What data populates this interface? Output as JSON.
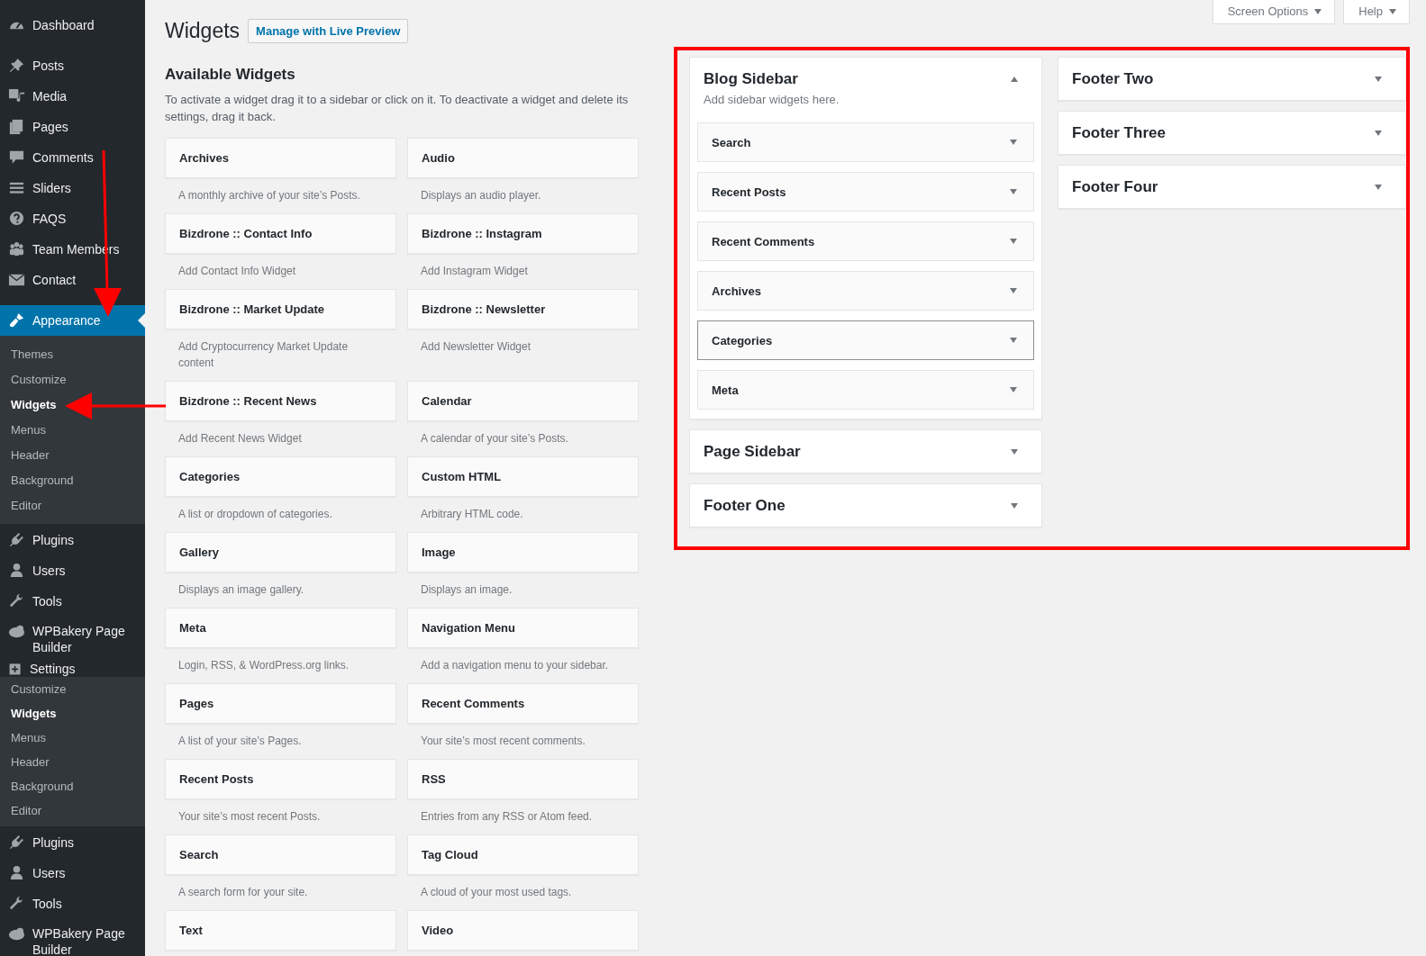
{
  "admin_menu": [
    {
      "kind": "item",
      "label": "Dashboard",
      "selected": false
    },
    {
      "kind": "separator"
    },
    {
      "kind": "item",
      "label": "Posts",
      "selected": false
    },
    {
      "kind": "item",
      "label": "Media",
      "selected": false
    },
    {
      "kind": "item",
      "label": "Pages",
      "selected": false
    },
    {
      "kind": "item",
      "label": "Comments",
      "selected": false
    },
    {
      "kind": "item",
      "label": "Sliders",
      "selected": false
    },
    {
      "kind": "item",
      "label": "FAQS",
      "selected": false
    },
    {
      "kind": "item",
      "label": "Team Members",
      "selected": false
    },
    {
      "kind": "item",
      "label": "Contact",
      "selected": false
    },
    {
      "kind": "separator"
    },
    {
      "kind": "item",
      "label": "Appearance",
      "selected": true
    },
    {
      "kind": "submenu",
      "items": [
        {
          "label": "Themes",
          "selected": false
        },
        {
          "label": "Customize",
          "selected": false
        },
        {
          "label": "Widgets",
          "selected": true
        },
        {
          "label": "Menus",
          "selected": false
        },
        {
          "label": "Header",
          "selected": false
        },
        {
          "label": "Background",
          "selected": false
        },
        {
          "label": "Editor",
          "selected": false
        }
      ]
    },
    {
      "kind": "item",
      "label": "Plugins",
      "selected": false
    },
    {
      "kind": "item",
      "label": "Users",
      "selected": false
    },
    {
      "kind": "item",
      "label": "Tools",
      "selected": false
    },
    {
      "kind": "item",
      "label": "WPBakery Page Builder",
      "selected": false
    },
    {
      "kind": "item",
      "label": "Settings",
      "selected": false
    },
    {
      "kind": "submenu",
      "items": [
        {
          "label": "Customize",
          "selected": false
        },
        {
          "label": "Widgets",
          "selected": true
        },
        {
          "label": "Menus",
          "selected": false
        },
        {
          "label": "Header",
          "selected": false
        },
        {
          "label": "Background",
          "selected": false
        },
        {
          "label": "Editor",
          "selected": false
        }
      ]
    },
    {
      "kind": "item",
      "label": "Plugins",
      "selected": false
    },
    {
      "kind": "item",
      "label": "Users",
      "selected": false
    },
    {
      "kind": "item",
      "label": "Tools",
      "selected": false
    },
    {
      "kind": "item",
      "label": "WPBakery Page Builder",
      "selected": false
    }
  ],
  "screen_meta": [
    "Screen Options",
    "Help"
  ],
  "page": {
    "title": "Widgets",
    "action": "Manage with Live Preview"
  },
  "available_widgets": {
    "heading": "Available Widgets",
    "description": "To activate a widget drag it to a sidebar or click on it. To deactivate a widget and delete its settings, drag it back.",
    "widgets": [
      {
        "name": "Archives",
        "description": "A monthly archive of your site’s Posts."
      },
      {
        "name": "Audio",
        "description": "Displays an audio player."
      },
      {
        "name": "Bizdrone :: Contact Info",
        "description": "Add Contact Info Widget"
      },
      {
        "name": "Bizdrone :: Instagram",
        "description": "Add Instagram Widget"
      },
      {
        "name": "Bizdrone :: Market Update",
        "description": "Add Cryptocurrency Market Update content"
      },
      {
        "name": "Bizdrone :: Newsletter",
        "description": "Add Newsletter Widget"
      },
      {
        "name": "Bizdrone :: Recent News",
        "description": "Add Recent News Widget"
      },
      {
        "name": "Calendar",
        "description": "A calendar of your site’s Posts."
      },
      {
        "name": "Categories",
        "description": "A list or dropdown of categories."
      },
      {
        "name": "Custom HTML",
        "description": "Arbitrary HTML code."
      },
      {
        "name": "Gallery",
        "description": "Displays an image gallery."
      },
      {
        "name": "Image",
        "description": "Displays an image."
      },
      {
        "name": "Meta",
        "description": "Login, RSS, & WordPress.org links."
      },
      {
        "name": "Navigation Menu",
        "description": "Add a navigation menu to your sidebar."
      },
      {
        "name": "Pages",
        "description": "A list of your site’s Pages."
      },
      {
        "name": "Recent Comments",
        "description": "Your site’s most recent comments."
      },
      {
        "name": "Recent Posts",
        "description": "Your site’s most recent Posts."
      },
      {
        "name": "RSS",
        "description": "Entries from any RSS or Atom feed."
      },
      {
        "name": "Search",
        "description": "A search form for your site."
      },
      {
        "name": "Tag Cloud",
        "description": "A cloud of your most used tags."
      },
      {
        "name": "Text"
      },
      {
        "name": "Video"
      }
    ]
  },
  "sidebars": {
    "columns": [
      [
        {
          "title": "Blog Sidebar",
          "description": "Add sidebar widgets here.",
          "expanded": true,
          "widgets": [
            {
              "name": "Search",
              "focused": false
            },
            {
              "name": "Recent Posts",
              "focused": false
            },
            {
              "name": "Recent Comments",
              "focused": false
            },
            {
              "name": "Archives",
              "focused": false
            },
            {
              "name": "Categories",
              "focused": true
            },
            {
              "name": "Meta",
              "focused": false
            }
          ]
        },
        {
          "title": "Page Sidebar",
          "expanded": false
        },
        {
          "title": "Footer One",
          "expanded": false
        }
      ],
      [
        {
          "title": "Footer Two",
          "expanded": false
        },
        {
          "title": "Footer Three",
          "expanded": false
        },
        {
          "title": "Footer Four",
          "expanded": false
        }
      ]
    ]
  }
}
